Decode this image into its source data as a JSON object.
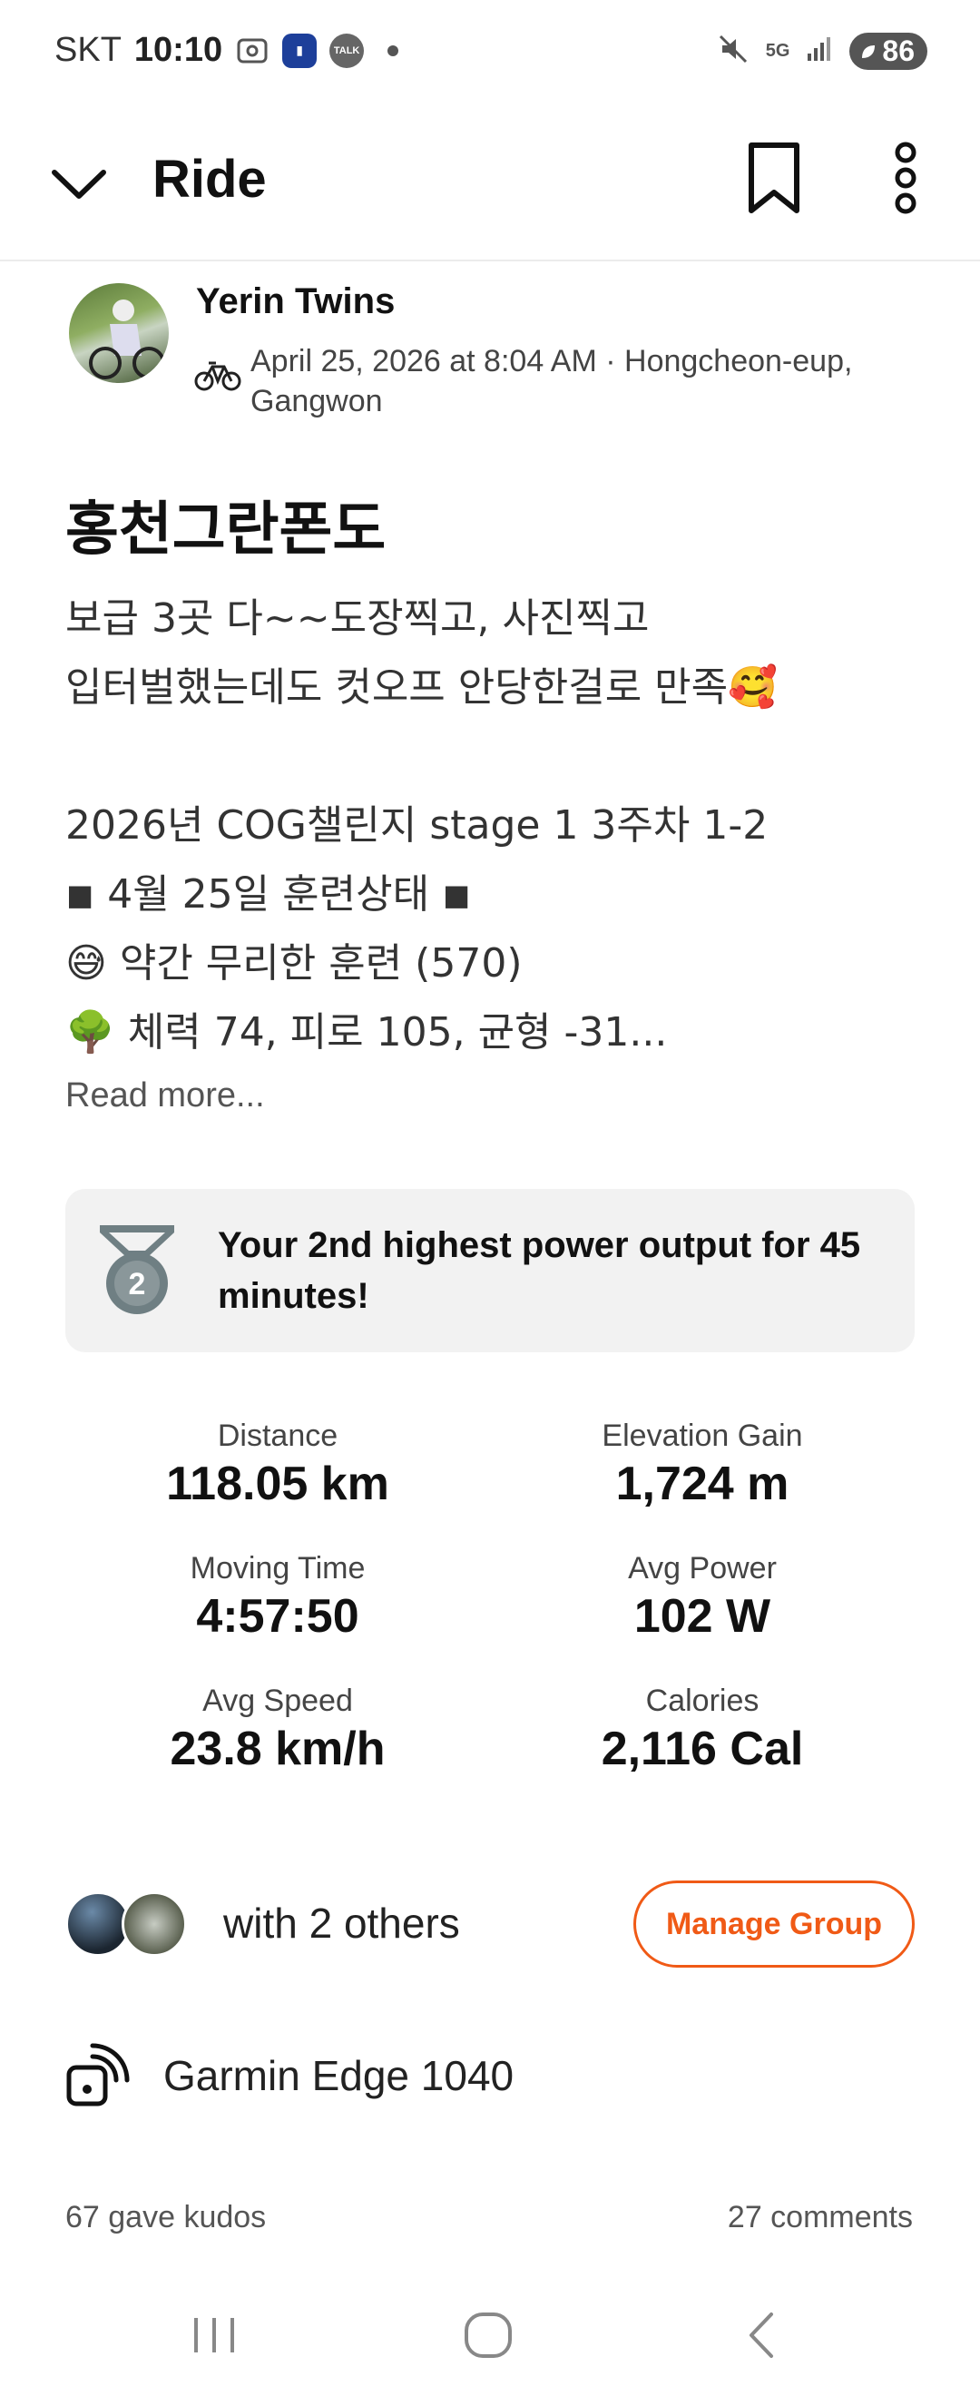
{
  "status_bar": {
    "carrier": "SKT",
    "time": "10:10",
    "notif_icons": [
      "screenshot-icon",
      "bank-app-icon",
      "talk-icon",
      "dot-icon"
    ],
    "talk_label": "TALK",
    "network": "5G",
    "battery": "86"
  },
  "nav": {
    "title": "Ride"
  },
  "author": {
    "name": "Yerin Twins",
    "meta": "April 25, 2026 at 8:04 AM · Hongcheon-eup, Gangwon"
  },
  "activity": {
    "title": "홍천그란폰도",
    "description": "보급 3곳 다~~도장찍고, 사진찍고\n입터벌했는데도 컷오프 안당한걸로 만족🥰\n\n2026년 COG챌린지 stage 1 3주차 1-2\n◾ 4월 25일 훈련상태 ◾\n😅 약간 무리한 훈련 (570)\n🌳 체력 74, 피로 105, 균형 -31...",
    "read_more": "Read more..."
  },
  "achievement": {
    "medal_number": "2",
    "text": "Your 2nd highest power output for 45 minutes!"
  },
  "stats": [
    {
      "label": "Distance",
      "value": "118.05 km"
    },
    {
      "label": "Elevation Gain",
      "value": "1,724 m"
    },
    {
      "label": "Moving Time",
      "value": "4:57:50"
    },
    {
      "label": "Avg Power",
      "value": "102 W"
    },
    {
      "label": "Avg Speed",
      "value": "23.8 km/h"
    },
    {
      "label": "Calories",
      "value": "2,116 Cal"
    }
  ],
  "group": {
    "text": "with 2 others",
    "button": "Manage Group"
  },
  "device": {
    "name": "Garmin Edge 1040"
  },
  "social": {
    "kudos": "67 gave kudos",
    "comments": "27 comments"
  },
  "colors": {
    "accent": "#f05a16",
    "card_bg": "#f2f2f2",
    "medal": "#6f7f83"
  }
}
